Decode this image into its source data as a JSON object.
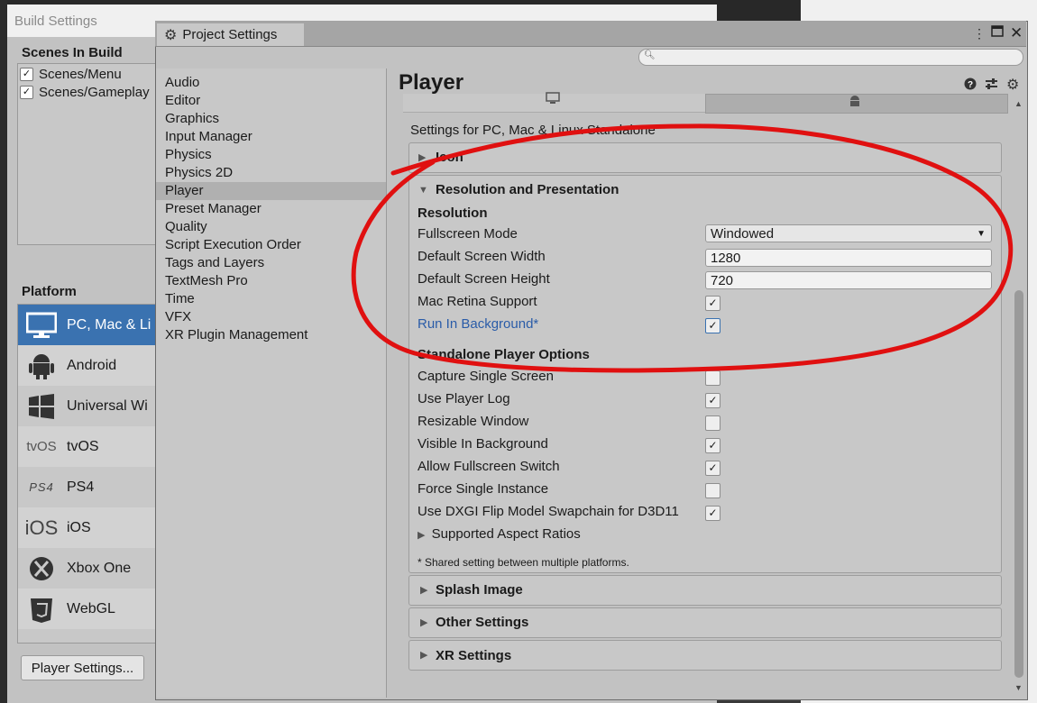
{
  "build_settings": {
    "title": "Build Settings",
    "scenes_header": "Scenes In Build",
    "scenes": [
      {
        "name": "Scenes/Menu",
        "checked": true
      },
      {
        "name": "Scenes/Gameplay",
        "checked": true
      }
    ],
    "platform_header": "Platform",
    "platforms": [
      {
        "label": "PC, Mac & Li",
        "icon": "monitor-icon",
        "selected": true
      },
      {
        "label": "Android",
        "icon": "android-icon"
      },
      {
        "label": "Universal Wi",
        "icon": "windows-icon"
      },
      {
        "label": "tvOS",
        "icon": "tvos-icon",
        "icon_text": "tvOS"
      },
      {
        "label": "PS4",
        "icon": "ps4-icon",
        "icon_text": "PS4"
      },
      {
        "label": "iOS",
        "icon": "ios-icon",
        "icon_text": "iOS"
      },
      {
        "label": "Xbox One",
        "icon": "xbox-icon"
      },
      {
        "label": "WebGL",
        "icon": "html5-icon"
      }
    ],
    "player_settings_button": "Player Settings..."
  },
  "project_settings": {
    "tab_title": "Project Settings",
    "search_placeholder": "",
    "nav": [
      "Audio",
      "Editor",
      "Graphics",
      "Input Manager",
      "Physics",
      "Physics 2D",
      "Player",
      "Preset Manager",
      "Quality",
      "Script Execution Order",
      "Tags and Layers",
      "TextMesh Pro",
      "Time",
      "VFX",
      "XR Plugin Management"
    ],
    "selected_nav": "Player",
    "page_title": "Player",
    "settings_for": "Settings for PC, Mac & Linux Standalone",
    "sections": {
      "icon": "Icon",
      "resolution": "Resolution and Presentation",
      "splash": "Splash Image",
      "other": "Other Settings",
      "xr": "XR Settings"
    },
    "resolution_header": "Resolution",
    "fullscreen_mode_label": "Fullscreen Mode",
    "fullscreen_mode_value": "Windowed",
    "default_width_label": "Default Screen Width",
    "default_width_value": "1280",
    "default_height_label": "Default Screen Height",
    "default_height_value": "720",
    "mac_retina_label": "Mac Retina Support",
    "run_bg_label": "Run In Background*",
    "standalone_header": "Standalone Player Options",
    "options": [
      {
        "label": "Capture Single Screen",
        "checked": false
      },
      {
        "label": "Use Player Log",
        "checked": true
      },
      {
        "label": "Resizable Window",
        "checked": false
      },
      {
        "label": "Visible In Background",
        "checked": true
      },
      {
        "label": "Allow Fullscreen Switch",
        "checked": true
      },
      {
        "label": "Force Single Instance",
        "checked": false
      },
      {
        "label": "Use DXGI Flip Model Swapchain for D3D11",
        "checked": true
      }
    ],
    "aspect_ratios": "Supported Aspect Ratios",
    "shared_note": "* Shared setting between multiple platforms."
  },
  "colors": {
    "annotation": "#e01010",
    "selection": "#3a72b0",
    "link": "#2a5ca8"
  }
}
